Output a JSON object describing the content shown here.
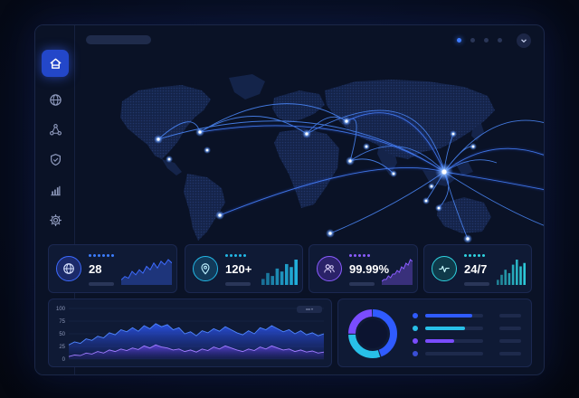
{
  "sidebar": {
    "items": [
      {
        "name": "home",
        "icon": "home-icon",
        "active": true
      },
      {
        "name": "globe",
        "icon": "globe-icon",
        "active": false
      },
      {
        "name": "network",
        "icon": "network-icon",
        "active": false
      },
      {
        "name": "shield",
        "icon": "shield-icon",
        "active": false
      },
      {
        "name": "bar-chart",
        "icon": "bar-chart-icon",
        "active": false
      },
      {
        "name": "settings",
        "icon": "gear-icon",
        "active": false
      }
    ]
  },
  "topbar": {
    "pagination": [
      true,
      false,
      false,
      false
    ]
  },
  "stats": [
    {
      "value": "28",
      "icon": "globe-icon",
      "accent": "#3d6bff",
      "spark": "area",
      "points": [
        3,
        5,
        4,
        8,
        6,
        9,
        7,
        11,
        9,
        13,
        10,
        14,
        12,
        15,
        13
      ]
    },
    {
      "value": "120+",
      "icon": "location-pin-icon",
      "accent": "#23b7e5",
      "spark": "bars",
      "points": [
        4,
        8,
        6,
        11,
        9,
        14,
        12,
        17
      ]
    },
    {
      "value": "99.99%",
      "icon": "users-icon",
      "accent": "#8a5cff",
      "spark": "area",
      "points": [
        2,
        3,
        3,
        5,
        4,
        6,
        6,
        8,
        7,
        10,
        9,
        12,
        11,
        14,
        13
      ]
    },
    {
      "value": "24/7",
      "icon": "pulse-icon",
      "accent": "#2fd3e0",
      "spark": "bars",
      "points": [
        3,
        6,
        9,
        7,
        12,
        15,
        11,
        13
      ]
    }
  ],
  "area_chart": {
    "y_ticks": [
      "100",
      "75",
      "50",
      "25",
      "0"
    ],
    "series_top": [
      28,
      34,
      31,
      40,
      37,
      45,
      42,
      52,
      48,
      58,
      54,
      62,
      55,
      66,
      60,
      70,
      64,
      68,
      58,
      62,
      50,
      54,
      46,
      56,
      52,
      60,
      55,
      64,
      58,
      52,
      48,
      56,
      50,
      62,
      58,
      66,
      60,
      54,
      58,
      50,
      56,
      48,
      52,
      46,
      50
    ],
    "series_bottom": [
      5,
      8,
      7,
      12,
      10,
      15,
      12,
      18,
      15,
      20,
      17,
      22,
      19,
      26,
      22,
      28,
      24,
      22,
      18,
      20,
      15,
      18,
      14,
      20,
      17,
      24,
      20,
      26,
      22,
      18,
      15,
      20,
      17,
      24,
      20,
      26,
      22,
      18,
      20,
      15,
      18,
      14,
      16,
      12,
      14
    ]
  },
  "donut": {
    "segments": [
      {
        "value": 45,
        "color": "#2f5bff"
      },
      {
        "value": 30,
        "color": "#28c0e8"
      },
      {
        "value": 25,
        "color": "#7a4cff"
      }
    ]
  },
  "legend": [
    {
      "color": "#2f5bff",
      "fill": 0.82
    },
    {
      "color": "#28c0e8",
      "fill": 0.68
    },
    {
      "color": "#7a4cff",
      "fill": 0.5
    },
    {
      "color": "#3a4fd6",
      "fill": 0.0
    }
  ],
  "colors": {
    "accent": "#3d7bff",
    "card_bg": "#0f1a35",
    "map_land": "#1a2b55",
    "arc": "#4d8bff"
  }
}
